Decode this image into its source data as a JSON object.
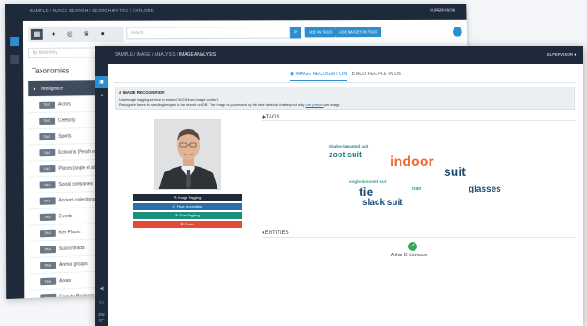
{
  "back_window": {
    "breadcrumb": "SAMPLE / IMAGE SEARCH / SEARCH BY TAG / EXPLORE",
    "user": "SUPERVISOR",
    "search_placeholder": "search",
    "buttons": [
      "ADD IN TAGS",
      "ADD IMAGES IN TAGS"
    ],
    "filter_placeholder": "by taxonomy",
    "taxonomies_title": "Taxonomies",
    "taxonomies": [
      {
        "tag": "",
        "label": "Intelligence"
      },
      {
        "tag": "TAG",
        "label": "Actors"
      },
      {
        "tag": "TAG",
        "label": "Celebrity"
      },
      {
        "tag": "TAG",
        "label": "Sports"
      },
      {
        "tag": "TAG",
        "label": "Ecrivains (Pesch et al.)"
      },
      {
        "tag": "TAG",
        "label": "Places (angle et al)"
      },
      {
        "tag": "TAG",
        "label": "Social companies"
      },
      {
        "tag": "TAG",
        "label": "Ancient collections"
      },
      {
        "tag": "TAG",
        "label": "Events"
      },
      {
        "tag": "TAG",
        "label": "Key Places"
      },
      {
        "tag": "TAG",
        "label": "Subcontracts"
      },
      {
        "tag": "TAG",
        "label": "Animal groups"
      },
      {
        "tag": "TAG",
        "label": "Areas"
      },
      {
        "tag": "TAG",
        "label": "Face by Business owner"
      }
    ]
  },
  "front_window": {
    "breadcrumb_path": "SAMPLE / IMAGE / ANALYSIS / ",
    "breadcrumb_current": "IMAGE ANALYSIS",
    "user": "SUPERVISOR",
    "sidebar_icons": [
      "home-icon",
      "gear-icon",
      "back-icon",
      "monitor-icon",
      "logo-icon"
    ],
    "tabs": [
      {
        "label": "IMAGE RECOGNITION",
        "icon": "eye-icon",
        "active": true
      },
      {
        "label": "ADD PEOPLE IN DB",
        "icon": "camera-icon",
        "active": false
      }
    ],
    "info": {
      "title": "IMAGE RECOGNITION",
      "line1": "Use image tagging service to extract TAGS from image content.",
      "line2_a": "Recognize faces by sending images to be search on DB. The image is processed by the face detector that expect only ",
      "line2_link": "one person",
      "line2_b": " per image."
    },
    "actions": [
      {
        "label": "Image Tagging",
        "icon": "tag-icon",
        "color": "#1e2a3a"
      },
      {
        "label": "Face recognition",
        "icon": "face-icon",
        "color": "#2c6fa8"
      },
      {
        "label": "Give Tagging",
        "icon": "tags-icon",
        "color": "#1a8f7b"
      },
      {
        "label": "Reset",
        "icon": "close-icon",
        "color": "#e04b3a"
      }
    ],
    "tags_heading": "TAGS",
    "tag_cloud": [
      {
        "text": "double-breasted suit",
        "color": "#2c7f8c"
      },
      {
        "text": "zoot suit",
        "color": "#2c7f8c"
      },
      {
        "text": "indoor",
        "color": "#f06a3a"
      },
      {
        "text": "suit",
        "color": "#1e4f7a"
      },
      {
        "text": "single-breasted suit",
        "color": "#2aa58a"
      },
      {
        "text": "tie",
        "color": "#1e4f7a"
      },
      {
        "text": "man",
        "color": "#2aa58a"
      },
      {
        "text": "glasses",
        "color": "#1e4f7a"
      },
      {
        "text": "slack suit",
        "color": "#1e4f7a"
      }
    ],
    "entities_heading": "ENTITIES",
    "entity_name": "Arthur D. Levinson"
  }
}
